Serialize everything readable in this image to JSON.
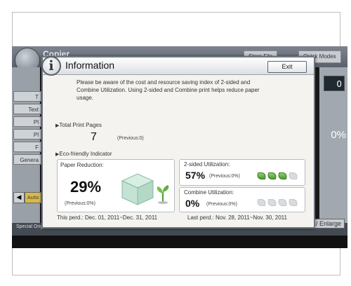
{
  "background": {
    "app_title": "Copier",
    "tab_store_file": "Store File",
    "tab_quick_modes": "Quick Modes",
    "left_buttons": [
      "T",
      "Text",
      "Pl",
      "Pl",
      "F",
      "Genera"
    ],
    "counter": "0",
    "right_percent": "0%",
    "enlarge": "/ Enlarge",
    "bottom_text": "Special Original",
    "auto_label": "Auto"
  },
  "dialog": {
    "title": "Information",
    "exit_label": "Exit",
    "message": "Please be aware of the cost and resource saving index of 2-sided and Combine Utilization. Using 2-sided and Combine print helps reduce paper usage.",
    "total_print_pages": {
      "label": "Total Print Pages",
      "value": "7",
      "previous": "(Previous:0)"
    },
    "eco_indicator": {
      "label": "Eco-friendly Indicator",
      "paper_reduction": {
        "label": "Paper Reduction:",
        "value": "29%",
        "previous": "(Previous:0%)"
      },
      "two_sided": {
        "label": "2-sided Utilization:",
        "value": "57%",
        "previous": "(Previous:0%)",
        "leaves_on": 3,
        "leaves_total": 4
      },
      "combine": {
        "label": "Combine Utilization:",
        "value": "0%",
        "previous": "(Previous:0%)",
        "leaves_on": 0,
        "leaves_total": 4
      }
    },
    "this_period": "This perd.: Dec. 01, 2011~Dec. 31, 2011",
    "last_period": "Last perd.: Nov. 28, 2011~Nov. 30, 2011"
  },
  "colors": {
    "leaf_on": "#5fae3c",
    "leaf_off": "#d9dcdf",
    "accent_auto": "#d9b94a"
  }
}
